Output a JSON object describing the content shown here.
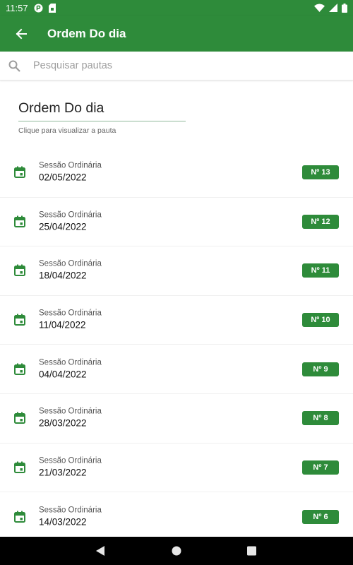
{
  "status_bar": {
    "time": "11:57",
    "icons_left": [
      "sync-icon",
      "sim-card-icon"
    ],
    "icons_right": [
      "wifi-icon",
      "signal-icon",
      "battery-icon"
    ]
  },
  "app_bar": {
    "title": "Ordem Do dia",
    "back_icon": "arrow-back-icon",
    "color": "#2e8b3a"
  },
  "search": {
    "placeholder": "Pesquisar pautas",
    "value": ""
  },
  "section": {
    "title": "Ordem Do dia",
    "subtitle": "Clique para visualizar a pauta"
  },
  "sessions": [
    {
      "type": "Sessão Ordinária",
      "date": "02/05/2022",
      "badge": "Nº 13"
    },
    {
      "type": "Sessão Ordinária",
      "date": "25/04/2022",
      "badge": "Nº 12"
    },
    {
      "type": "Sessão Ordinária",
      "date": "18/04/2022",
      "badge": "Nº 11"
    },
    {
      "type": "Sessão Ordinária",
      "date": "11/04/2022",
      "badge": "Nº 10"
    },
    {
      "type": "Sessão Ordinária",
      "date": "04/04/2022",
      "badge": "Nº 9"
    },
    {
      "type": "Sessão Ordinária",
      "date": "28/03/2022",
      "badge": "Nº 8"
    },
    {
      "type": "Sessão Ordinária",
      "date": "21/03/2022",
      "badge": "Nº 7"
    },
    {
      "type": "Sessão Ordinária",
      "date": "14/03/2022",
      "badge": "Nº 6"
    }
  ],
  "nav_bar": {
    "buttons": [
      "back-triangle-icon",
      "home-circle-icon",
      "recents-square-icon"
    ]
  }
}
